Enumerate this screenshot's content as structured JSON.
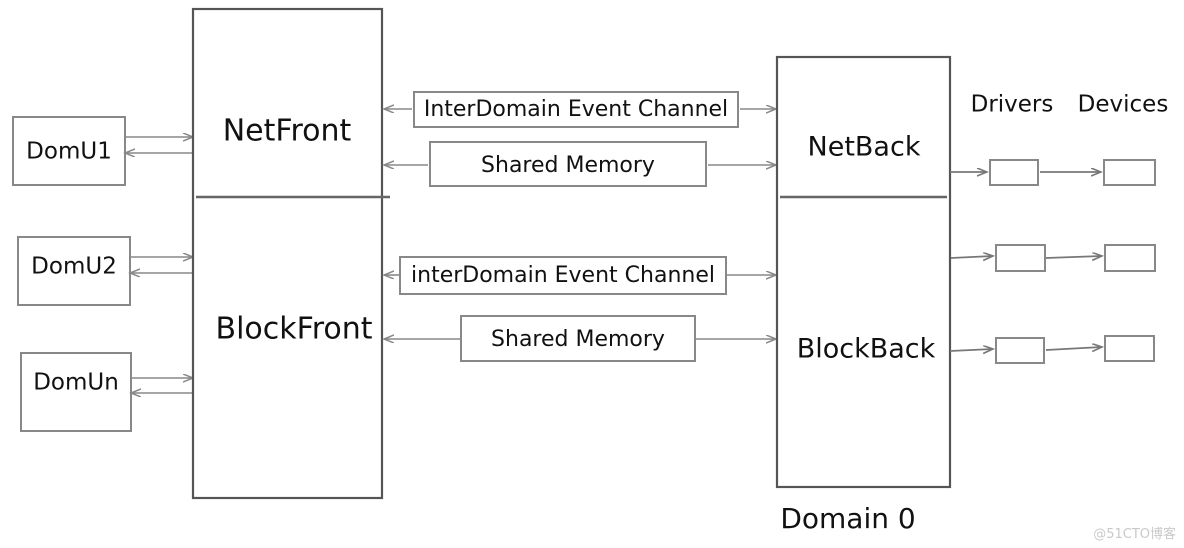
{
  "diagram": {
    "title_label": "Domain 0",
    "guests": [
      {
        "label": "DomU1"
      },
      {
        "label": "DomU2"
      },
      {
        "label": "DomUn"
      }
    ],
    "frontend": {
      "net_label": "NetFront",
      "block_label": "BlockFront"
    },
    "backend": {
      "net_label": "NetBack",
      "block_label": "BlockBack"
    },
    "channels": [
      {
        "label": "InterDomain Event Channel"
      },
      {
        "label": "Shared Memory"
      },
      {
        "label": "interDomain Event Channel"
      },
      {
        "label": "Shared Memory"
      }
    ],
    "columns": {
      "drivers_label": "Drivers",
      "devices_label": "Devices"
    },
    "driver_boxes": [
      {
        "label": ""
      },
      {
        "label": ""
      },
      {
        "label": ""
      }
    ],
    "device_boxes": [
      {
        "label": ""
      },
      {
        "label": ""
      },
      {
        "label": ""
      }
    ],
    "watermark": "@51CTO博客",
    "colors": {
      "box_stroke": "#888888",
      "box_stroke_dark": "#555555",
      "connector": "#888888",
      "text": "#111111",
      "background": "#ffffff"
    }
  }
}
